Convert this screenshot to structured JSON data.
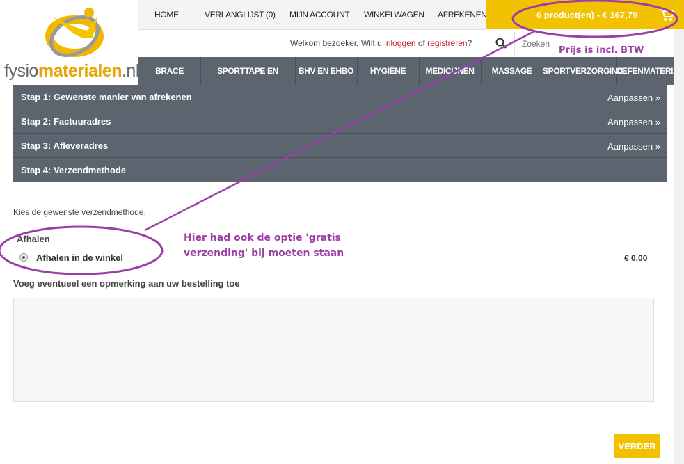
{
  "logo": {
    "text_part1": "fysio",
    "text_part2": "materialen",
    "text_part3": ".nl"
  },
  "topnav": [
    "HOME",
    "VERLANGLIJST (0)",
    "MIJN ACCOUNT",
    "WINKELWAGEN",
    "AFREKENEN"
  ],
  "cart": {
    "summary": "6 product(en) - € 167,79",
    "icon": "cart-icon"
  },
  "welcome": {
    "prefix": "Welkom bezoeker, Wilt u ",
    "login": "inloggen",
    "or": " of ",
    "register": "registreren",
    "suffix": "?"
  },
  "search": {
    "placeholder": "Zoeken",
    "icon": "search-icon"
  },
  "categories": [
    "BRACE",
    "SPORTTAPE EN BANDAGES",
    "BHV EN EHBO",
    "HYGIËNE",
    "MEDICIJNEN",
    "MASSAGE",
    "SPORTVERZORGING",
    "OEFENMATERIAAL"
  ],
  "steps": [
    {
      "label": "Stap 1: Gewenste manier van afrekenen",
      "action": "Aanpassen »"
    },
    {
      "label": "Stap 2: Factuuradres",
      "action": "Aanpassen »"
    },
    {
      "label": "Stap 3: Afleveradres",
      "action": "Aanpassen »"
    },
    {
      "label": "Stap 4: Verzendmethode",
      "action": ""
    }
  ],
  "shipping": {
    "intro": "Kies de gewenste verzendmethode.",
    "section_title": "Afhalen",
    "option_label": "Afhalen in de winkel",
    "option_price": "€ 0,00"
  },
  "note": {
    "title": "Voeg eventueel een opmerking aan uw bestelling toe",
    "value": ""
  },
  "continue_button": "VERDER",
  "annotations": {
    "price_note": "Prijs is incl. BTW",
    "shipping_note_line1": "Hier had ook de optie 'gratis",
    "shipping_note_line2": "verzending' bij moeten staan",
    "color": "#9b3fa6"
  },
  "colors": {
    "accent": "#f2c200",
    "nav": "#5c6470",
    "link": "#c8102e"
  }
}
